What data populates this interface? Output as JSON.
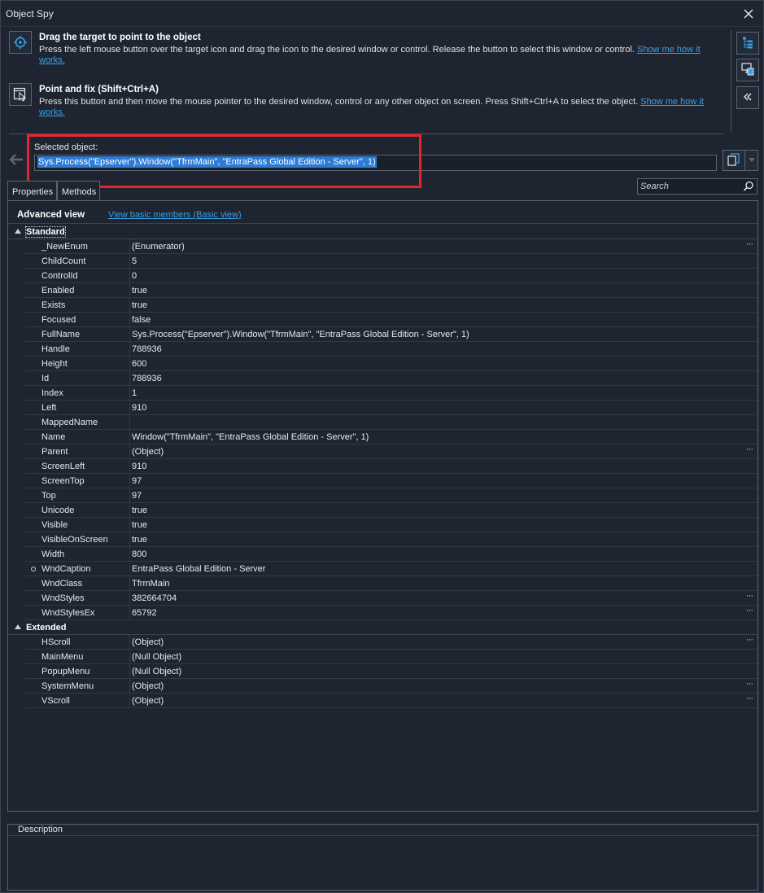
{
  "window": {
    "title": "Object Spy"
  },
  "instructions": [
    {
      "heading": "Drag the target to point to the object",
      "text": "Press the left mouse button over the target icon and drag the icon to the desired window or control. Release the button to select this window or control.",
      "link": "Show me how it works."
    },
    {
      "heading": "Point and fix (Shift+Ctrl+A)",
      "text": "Press this button and then move the mouse pointer to the desired window, control or any other object on screen. Press Shift+Ctrl+A to select the object.",
      "link": "Show me how it works."
    }
  ],
  "selected_object": {
    "label": "Selected object:",
    "value": "Sys.Process(\"Epserver\").Window(\"TfrmMain\", \"EntraPass Global Edition - Server\", 1)"
  },
  "tabs": [
    "Properties",
    "Methods"
  ],
  "search": {
    "placeholder": "Search"
  },
  "view": {
    "current": "Advanced view",
    "switch_link": "View basic members (Basic view)"
  },
  "categories": [
    {
      "name": "Standard",
      "rows": [
        {
          "name": "_NewEnum",
          "value": "(Enumerator)",
          "more": true
        },
        {
          "name": "ChildCount",
          "value": "5"
        },
        {
          "name": "ControlId",
          "value": "0"
        },
        {
          "name": "Enabled",
          "value": "true"
        },
        {
          "name": "Exists",
          "value": "true"
        },
        {
          "name": "Focused",
          "value": "false"
        },
        {
          "name": "FullName",
          "value": "Sys.Process(\"Epserver\").Window(\"TfrmMain\", \"EntraPass Global Edition - Server\", 1)"
        },
        {
          "name": "Handle",
          "value": "788936"
        },
        {
          "name": "Height",
          "value": "600"
        },
        {
          "name": "Id",
          "value": "788936"
        },
        {
          "name": "Index",
          "value": "1"
        },
        {
          "name": "Left",
          "value": "910"
        },
        {
          "name": "MappedName",
          "value": ""
        },
        {
          "name": "Name",
          "value": "Window(\"TfrmMain\", \"EntraPass Global Edition - Server\", 1)"
        },
        {
          "name": "Parent",
          "value": "(Object)",
          "more": true
        },
        {
          "name": "ScreenLeft",
          "value": "910"
        },
        {
          "name": "ScreenTop",
          "value": "97"
        },
        {
          "name": "Top",
          "value": "97"
        },
        {
          "name": "Unicode",
          "value": "true"
        },
        {
          "name": "Visible",
          "value": "true"
        },
        {
          "name": "VisibleOnScreen",
          "value": "true"
        },
        {
          "name": "Width",
          "value": "800"
        },
        {
          "name": "WndCaption",
          "value": "EntraPass Global Edition - Server",
          "marker": true
        },
        {
          "name": "WndClass",
          "value": "TfrmMain"
        },
        {
          "name": "WndStyles",
          "value": "382664704",
          "more": true
        },
        {
          "name": "WndStylesEx",
          "value": "65792",
          "more": true
        }
      ]
    },
    {
      "name": "Extended",
      "rows": [
        {
          "name": "HScroll",
          "value": "(Object)",
          "more": true
        },
        {
          "name": "MainMenu",
          "value": "(Null Object)"
        },
        {
          "name": "PopupMenu",
          "value": "(Null Object)"
        },
        {
          "name": "SystemMenu",
          "value": "(Object)",
          "more": true
        },
        {
          "name": "VScroll",
          "value": "(Object)",
          "more": true
        }
      ]
    }
  ],
  "description": {
    "label": "Description"
  },
  "icons": {
    "close": "close-icon",
    "target": "crosshair-target-icon",
    "point_fix": "point-and-fix-icon",
    "tree": "object-tree-icon",
    "highlight": "highlight-object-icon",
    "collapse": "double-chevron-left-icon",
    "back": "back-arrow-icon",
    "copy": "copy-icon",
    "search": "search-icon"
  }
}
